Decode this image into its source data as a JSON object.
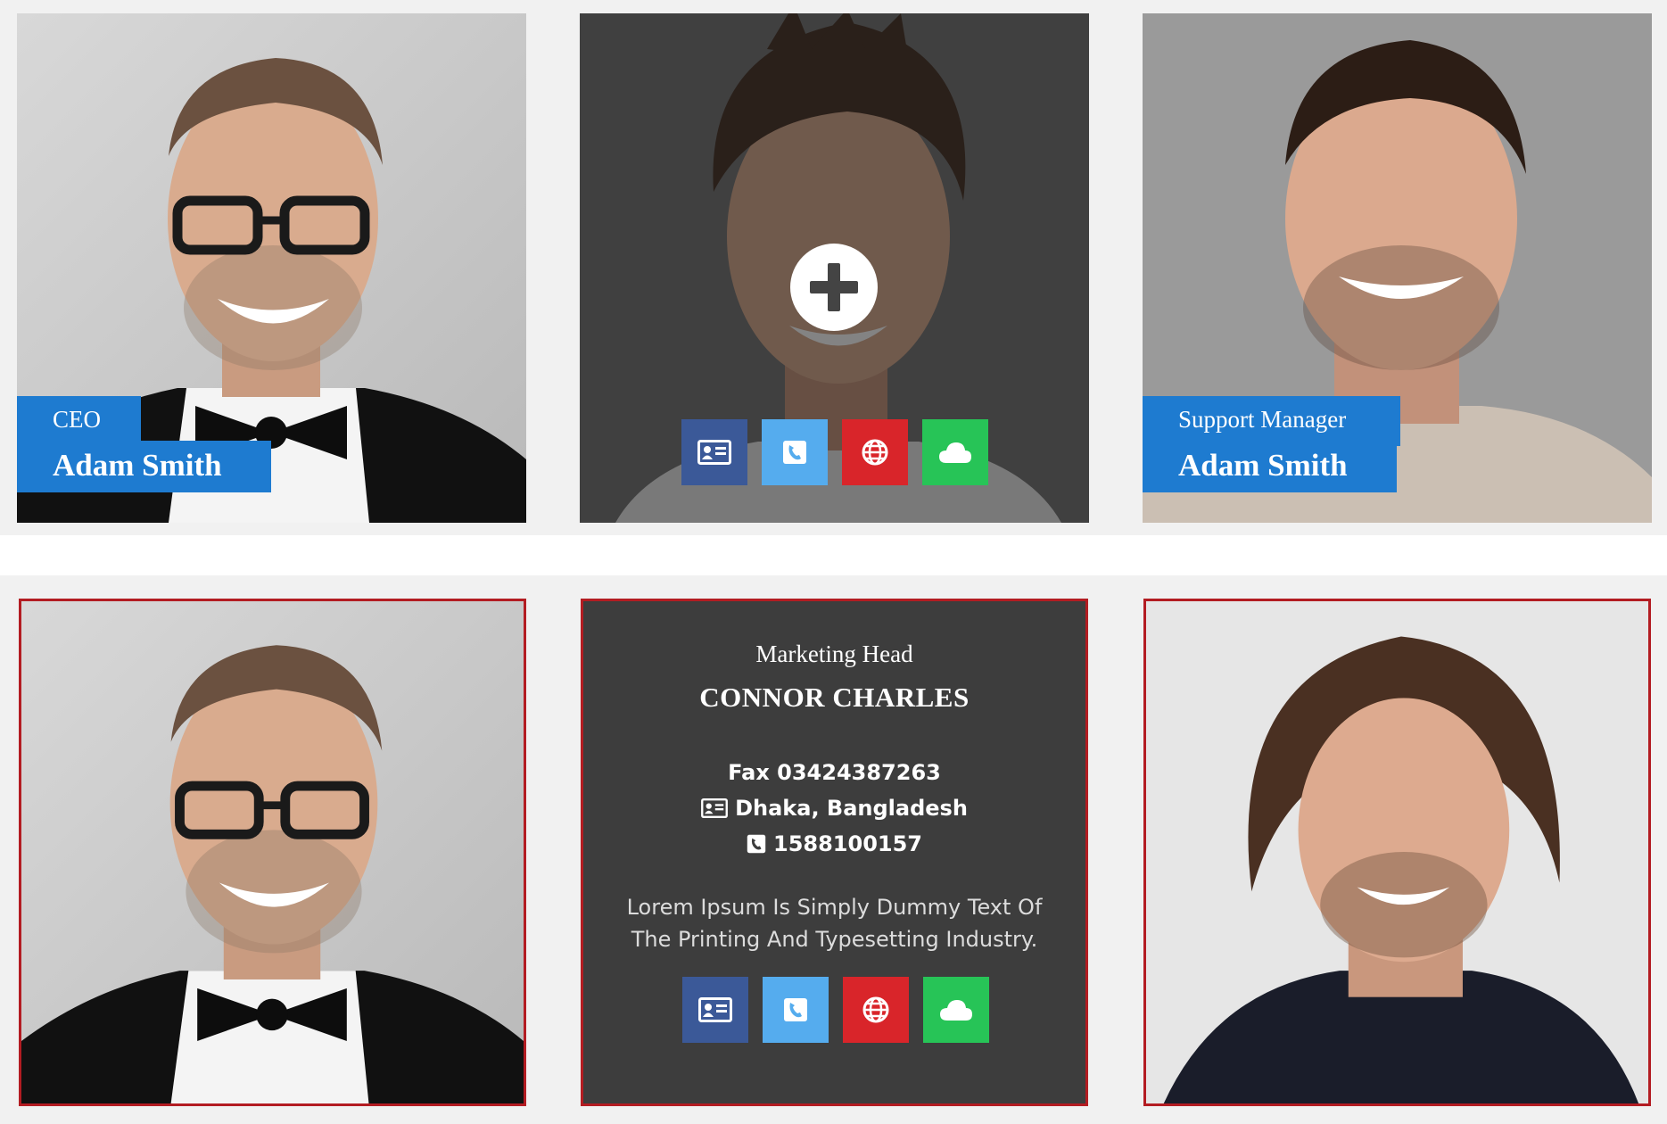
{
  "cards": {
    "card1": {
      "role": "CEO",
      "name": "Adam Smith"
    },
    "card3": {
      "role": "Support Manager",
      "name": "Adam Smith"
    },
    "info": {
      "role": "Marketing Head",
      "name": "CONNOR CHARLES",
      "fax": "Fax 03424387263",
      "address": "Dhaka, Bangladesh",
      "phone": "1588100157",
      "description": "Lorem Ipsum Is Simply Dummy Text Of The Printing And Typesetting Industry."
    }
  },
  "icons": [
    "plus-icon",
    "id-card-icon",
    "phone-icon",
    "globe-icon",
    "cloud-icon"
  ],
  "colors": {
    "tag_blue": "#1e7bd0",
    "card_border_red": "#b31c22",
    "info_bg": "#3d3d3d",
    "social_card": "#3b5998",
    "social_phone": "#55acee",
    "social_globe": "#d9252a",
    "social_cloud": "#27c457"
  }
}
